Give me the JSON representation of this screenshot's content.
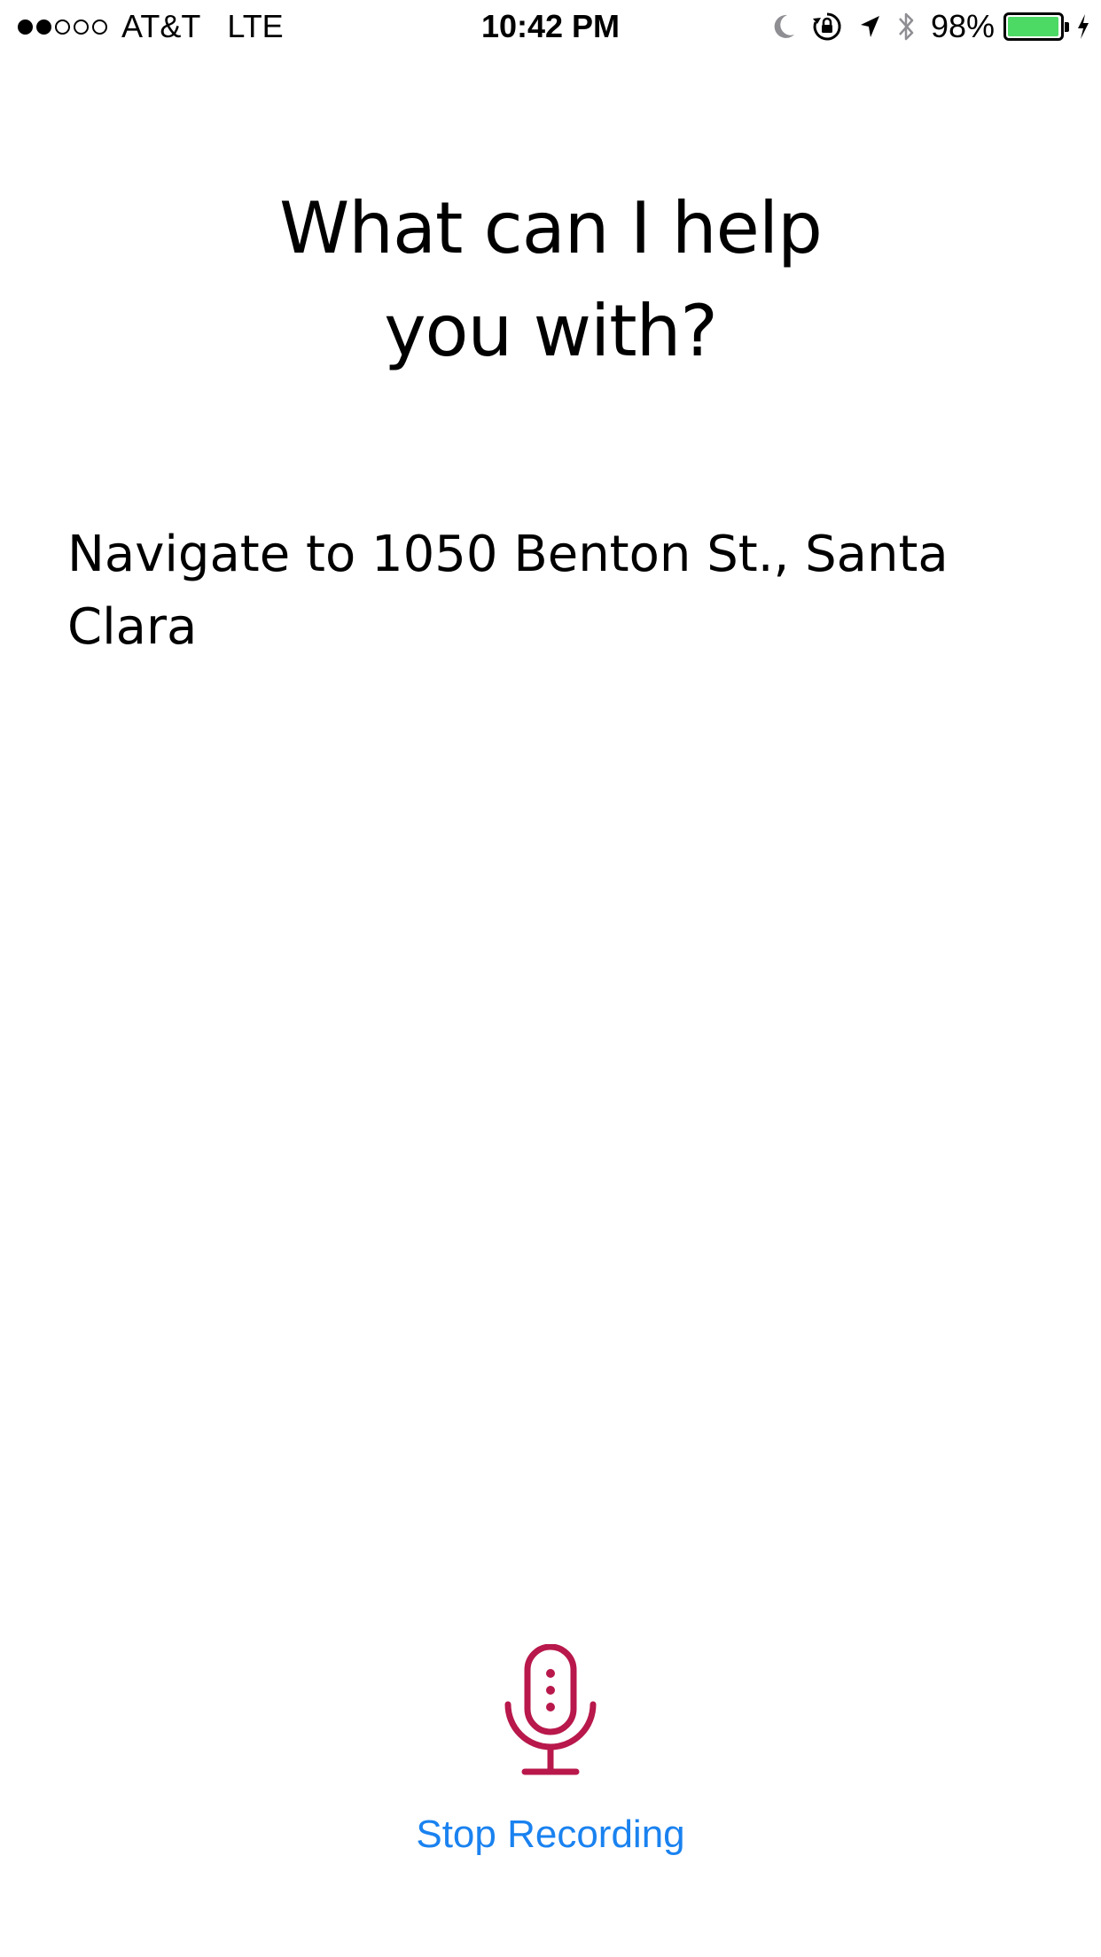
{
  "status_bar": {
    "signal_bars_filled": 2,
    "signal_bars_total": 5,
    "carrier": "AT&T",
    "network": "LTE",
    "time": "10:42 PM",
    "battery_percent_label": "98%",
    "battery_level": 0.98,
    "icons": [
      "moon-icon",
      "rotation-lock-icon",
      "location-arrow-icon",
      "bluetooth-icon",
      "battery-icon",
      "charging-bolt-icon"
    ]
  },
  "prompt": {
    "line1": "What can I help",
    "line2": "you with?"
  },
  "transcript": {
    "text": "Navigate to 1050 Benton St., Santa Clara"
  },
  "recording": {
    "stop_label": "Stop Recording",
    "mic_icon": "microphone-icon"
  },
  "colors": {
    "mic": "#b8184b",
    "link": "#1a82f0",
    "battery": "#4cd964"
  }
}
